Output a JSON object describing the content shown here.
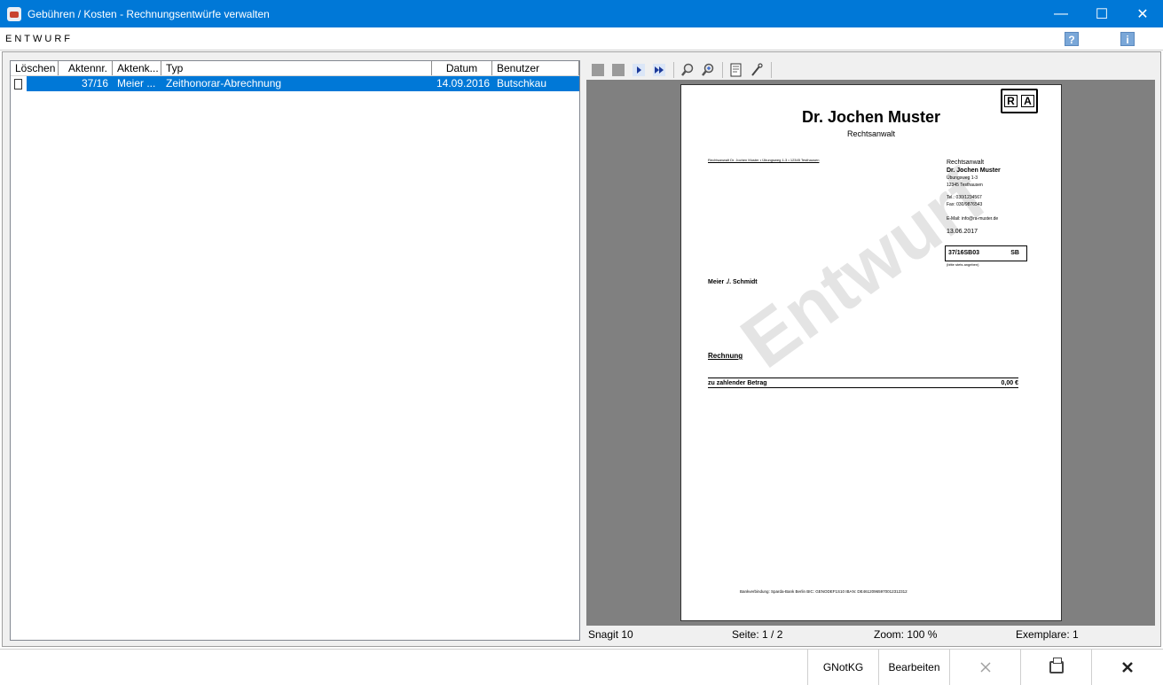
{
  "window": {
    "title": "Gebühren / Kosten - Rechnungsentwürfe verwalten",
    "minimize": "—",
    "maximize": "☐",
    "close": "✕"
  },
  "entwurf_bar": {
    "label": "ENTWURF",
    "help_icon_glyph": "?",
    "info_icon_glyph": "i"
  },
  "list": {
    "columns": [
      "Löschen",
      "Aktennr.",
      "Aktenk...",
      "Typ",
      "Datum",
      "Benutzer"
    ],
    "rows": [
      {
        "aktennr": "37/16",
        "aktenk": "Meier ...",
        "typ": "Zeithonorar-Abrechnung",
        "datum": "14.09.2016",
        "benutzer": "Butschkau"
      }
    ]
  },
  "preview": {
    "toolbar_icons": [
      "stop-icon",
      "stop-icon",
      "next-page-icon",
      "last-page-icon",
      "zoom-out-icon",
      "zoom-in-icon",
      "page-setup-icon",
      "tools-icon"
    ],
    "status": {
      "app": "Snagit 10",
      "page": "Seite: 1 / 2",
      "zoom": "Zoom: 100 %",
      "copies": "Exemplare: 1"
    },
    "document": {
      "logo_left": "R",
      "logo_right": "A",
      "name": "Dr. Jochen Muster",
      "role": "Rechtsanwalt",
      "sender_line": "Rechtsanwalt Dr. Jochen Muster • Übungsweg 1-3 • 12345 Testhausen",
      "right_block": {
        "title": "Rechtsanwalt",
        "name": "Dr. Jochen Muster",
        "street": "Übungsweg 1-3",
        "city": "12345 Testhausen",
        "tel": "Tel.: 030/1234567",
        "fax": "Fax: 030/9876543",
        "email": "E-Mail: info@ra-muster.de",
        "date": "13.06.2017"
      },
      "ref_number": "37/16SB03",
      "ref_code": "SB",
      "ref_note": "(bitte stets angeben)",
      "recipient": "Meier ./. Schmidt",
      "heading": "Rechnung",
      "amount_label": "zu zahlender Betrag",
      "amount_value": "0,00 €",
      "watermark": "Entwurf",
      "footer": "Bankverbindung:   Sparda-Bank Berlin   BIC: GENODEF1S10   IBAN: DE46120965970012312312"
    }
  },
  "bottom_buttons": {
    "gnotkg": "GNotKG",
    "bearbeiten": "Bearbeiten"
  }
}
